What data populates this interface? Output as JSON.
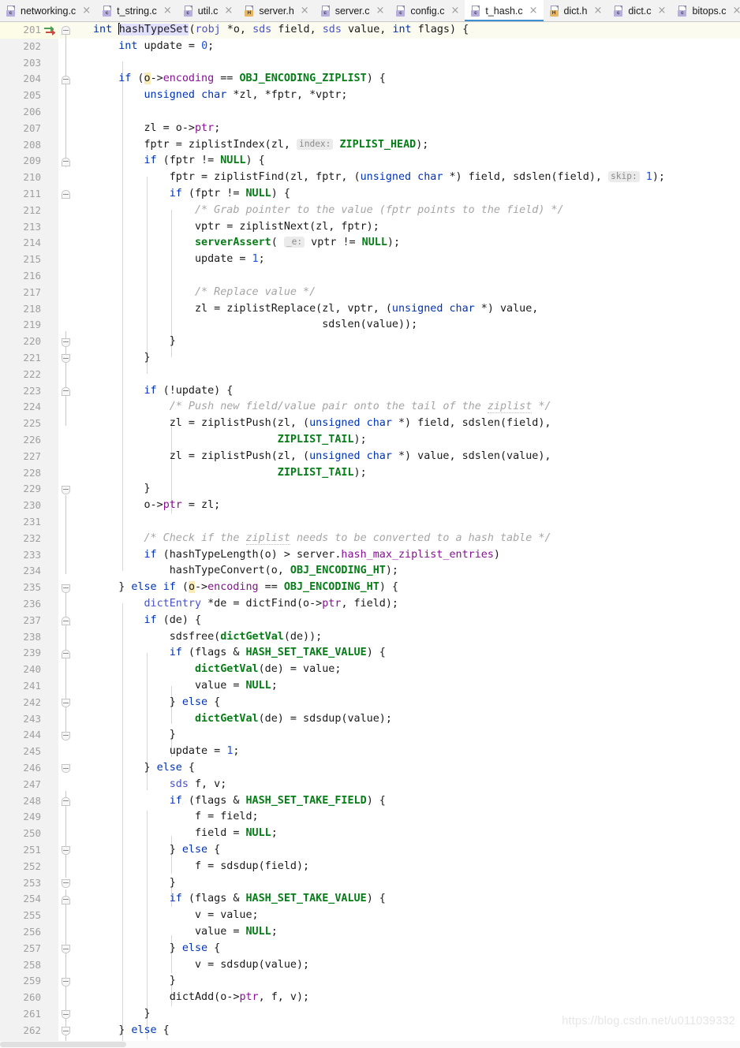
{
  "window": {
    "active_file": "t_hash.c",
    "accent_color": "#3c8ed1"
  },
  "tabs": [
    {
      "label": "networking.c",
      "icon": "c-file-icon",
      "kind": "c",
      "active": false
    },
    {
      "label": "t_string.c",
      "icon": "c-file-icon",
      "kind": "c",
      "active": false
    },
    {
      "label": "util.c",
      "icon": "c-file-icon",
      "kind": "c",
      "active": false
    },
    {
      "label": "server.h",
      "icon": "h-file-icon",
      "kind": "h",
      "active": false
    },
    {
      "label": "server.c",
      "icon": "c-file-icon",
      "kind": "c",
      "active": false
    },
    {
      "label": "config.c",
      "icon": "c-file-icon",
      "kind": "c",
      "active": false
    },
    {
      "label": "t_hash.c",
      "icon": "c-file-icon",
      "kind": "c",
      "active": true
    },
    {
      "label": "dict.h",
      "icon": "h-file-icon",
      "kind": "h",
      "active": false
    },
    {
      "label": "dict.c",
      "icon": "c-file-icon",
      "kind": "c",
      "active": false
    },
    {
      "label": "bitops.c",
      "icon": "c-file-icon",
      "kind": "c",
      "active": false
    }
  ],
  "tab_close_glyph": "×",
  "editor": {
    "first_line_number": 201,
    "caret_line_number": 201,
    "syntax_colors": {
      "keyword": "#0033b3",
      "typedef": "#4a52c4",
      "number": "#1750eb",
      "macro": "#067d17",
      "struct_field": "#871094",
      "comment": "#a5a5a5",
      "plain": "#1a1a1a",
      "identifier_highlight_bg": "#e2e0ff",
      "occurrence_highlight_bg": "#f7ecb5",
      "caret_row_bg": "#fcfbf0",
      "inlay_hint_bg": "#ebebeb",
      "inlay_hint_fg": "#8b8b8b"
    },
    "lines": [
      {
        "n": 201,
        "text": "int hashTypeSet(robj *o, sds field, sds value, int flags) {"
      },
      {
        "n": 202,
        "text": "    int update = 0;"
      },
      {
        "n": 203,
        "text": ""
      },
      {
        "n": 204,
        "text": "    if (o->encoding == OBJ_ENCODING_ZIPLIST) {"
      },
      {
        "n": 205,
        "text": "        unsigned char *zl, *fptr, *vptr;"
      },
      {
        "n": 206,
        "text": ""
      },
      {
        "n": 207,
        "text": "        zl = o->ptr;"
      },
      {
        "n": 208,
        "text": "        fptr = ziplistIndex(zl, index: ZIPLIST_HEAD);"
      },
      {
        "n": 209,
        "text": "        if (fptr != NULL) {"
      },
      {
        "n": 210,
        "text": "            fptr = ziplistFind(zl, fptr, (unsigned char *) field, sdslen(field), skip: 1);"
      },
      {
        "n": 211,
        "text": "            if (fptr != NULL) {"
      },
      {
        "n": 212,
        "text": "                /* Grab pointer to the value (fptr points to the field) */"
      },
      {
        "n": 213,
        "text": "                vptr = ziplistNext(zl, fptr);"
      },
      {
        "n": 214,
        "text": "                serverAssert( _e: vptr != NULL);"
      },
      {
        "n": 215,
        "text": "                update = 1;"
      },
      {
        "n": 216,
        "text": ""
      },
      {
        "n": 217,
        "text": "                /* Replace value */"
      },
      {
        "n": 218,
        "text": "                zl = ziplistReplace(zl, vptr, (unsigned char *) value,"
      },
      {
        "n": 219,
        "text": "                                    sdslen(value));"
      },
      {
        "n": 220,
        "text": "            }"
      },
      {
        "n": 221,
        "text": "        }"
      },
      {
        "n": 222,
        "text": ""
      },
      {
        "n": 223,
        "text": "        if (!update) {"
      },
      {
        "n": 224,
        "text": "            /* Push new field/value pair onto the tail of the ziplist */"
      },
      {
        "n": 225,
        "text": "            zl = ziplistPush(zl, (unsigned char *) field, sdslen(field),"
      },
      {
        "n": 226,
        "text": "                             ZIPLIST_TAIL);"
      },
      {
        "n": 227,
        "text": "            zl = ziplistPush(zl, (unsigned char *) value, sdslen(value),"
      },
      {
        "n": 228,
        "text": "                             ZIPLIST_TAIL);"
      },
      {
        "n": 229,
        "text": "        }"
      },
      {
        "n": 230,
        "text": "        o->ptr = zl;"
      },
      {
        "n": 231,
        "text": ""
      },
      {
        "n": 232,
        "text": "        /* Check if the ziplist needs to be converted to a hash table */"
      },
      {
        "n": 233,
        "text": "        if (hashTypeLength(o) > server.hash_max_ziplist_entries)"
      },
      {
        "n": 234,
        "text": "            hashTypeConvert(o, OBJ_ENCODING_HT);"
      },
      {
        "n": 235,
        "text": "    } else if (o->encoding == OBJ_ENCODING_HT) {"
      },
      {
        "n": 236,
        "text": "        dictEntry *de = dictFind(o->ptr, field);"
      },
      {
        "n": 237,
        "text": "        if (de) {"
      },
      {
        "n": 238,
        "text": "            sdsfree(dictGetVal(de));"
      },
      {
        "n": 239,
        "text": "            if (flags & HASH_SET_TAKE_VALUE) {"
      },
      {
        "n": 240,
        "text": "                dictGetVal(de) = value;"
      },
      {
        "n": 241,
        "text": "                value = NULL;"
      },
      {
        "n": 242,
        "text": "            } else {"
      },
      {
        "n": 243,
        "text": "                dictGetVal(de) = sdsdup(value);"
      },
      {
        "n": 244,
        "text": "            }"
      },
      {
        "n": 245,
        "text": "            update = 1;"
      },
      {
        "n": 246,
        "text": "        } else {"
      },
      {
        "n": 247,
        "text": "            sds f, v;"
      },
      {
        "n": 248,
        "text": "            if (flags & HASH_SET_TAKE_FIELD) {"
      },
      {
        "n": 249,
        "text": "                f = field;"
      },
      {
        "n": 250,
        "text": "                field = NULL;"
      },
      {
        "n": 251,
        "text": "            } else {"
      },
      {
        "n": 252,
        "text": "                f = sdsdup(field);"
      },
      {
        "n": 253,
        "text": "            }"
      },
      {
        "n": 254,
        "text": "            if (flags & HASH_SET_TAKE_VALUE) {"
      },
      {
        "n": 255,
        "text": "                v = value;"
      },
      {
        "n": 256,
        "text": "                value = NULL;"
      },
      {
        "n": 257,
        "text": "            } else {"
      },
      {
        "n": 258,
        "text": "                v = sdsdup(value);"
      },
      {
        "n": 259,
        "text": "            }"
      },
      {
        "n": 260,
        "text": "            dictAdd(o->ptr, f, v);"
      },
      {
        "n": 261,
        "text": "        }"
      },
      {
        "n": 262,
        "text": "    } else {"
      }
    ],
    "inlay_hints": [
      {
        "line": 208,
        "label": "index:"
      },
      {
        "line": 210,
        "label": "skip:"
      },
      {
        "line": 214,
        "label": "_e:"
      }
    ],
    "fold_markers": [
      201,
      204,
      209,
      211,
      220,
      221,
      223,
      229,
      235,
      237,
      239,
      242,
      244,
      246,
      248,
      251,
      253,
      254,
      257,
      259,
      261,
      262
    ]
  },
  "watermark": {
    "text": "https://blog.csdn.net/u011039332"
  }
}
